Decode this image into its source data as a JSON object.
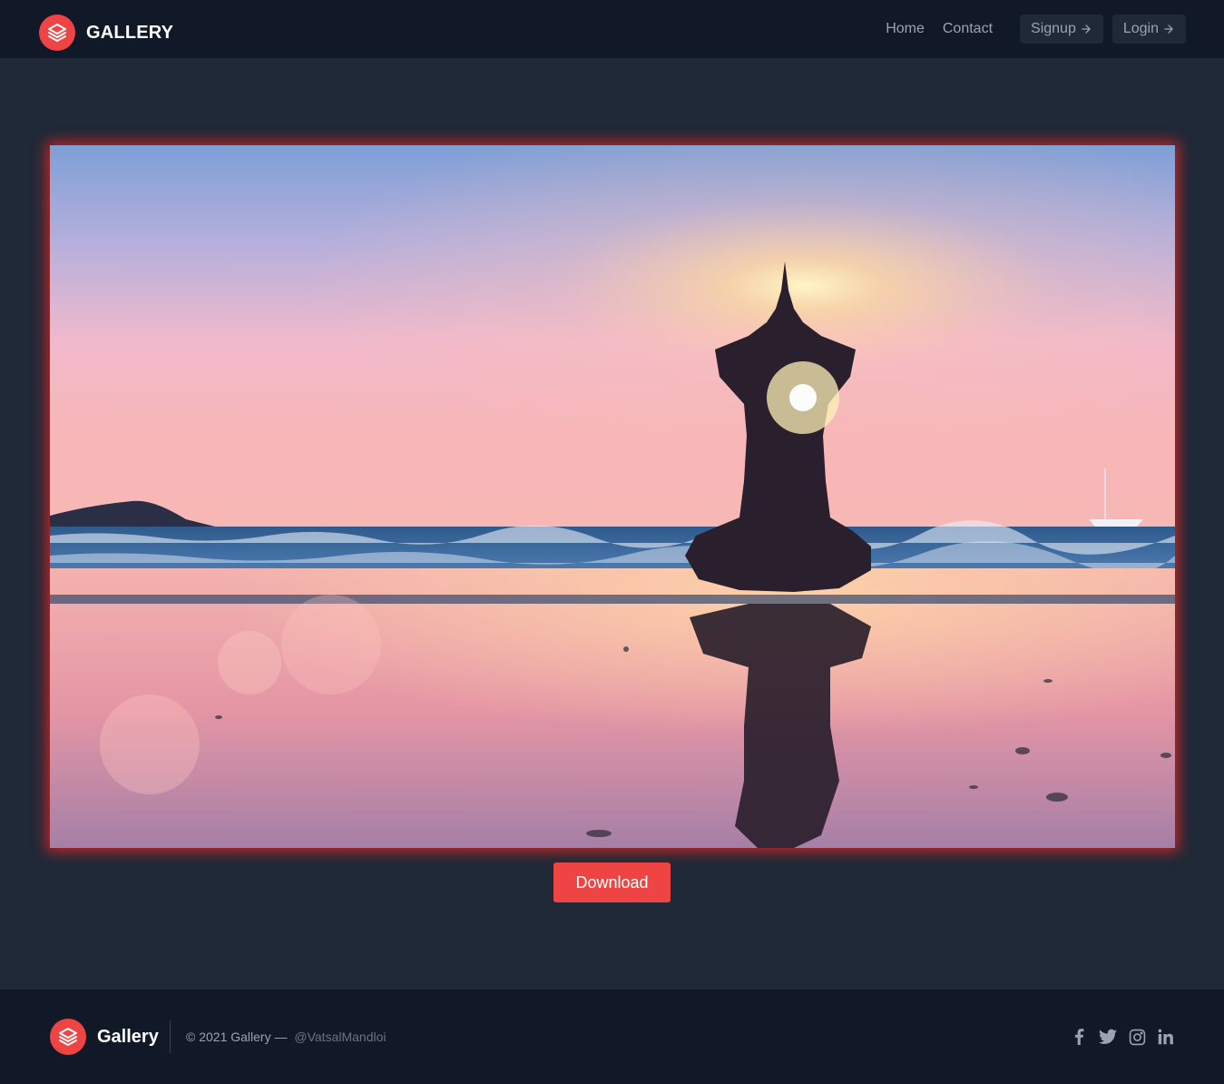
{
  "header": {
    "brand": "GALLERY",
    "nav": {
      "home": "Home",
      "contact": "Contact",
      "signup": "Signup",
      "login": "Login"
    }
  },
  "main": {
    "image_icon": "yoga-sunset-photo",
    "download_label": "Download"
  },
  "footer": {
    "brand": "Gallery",
    "copyright": "© 2021 Gallery —",
    "handle": "@VatsalMandloi",
    "socials": [
      "facebook-icon",
      "twitter-icon",
      "instagram-icon",
      "linkedin-icon"
    ]
  },
  "colors": {
    "accent": "#ef4444",
    "background": "#1f2937",
    "header_bg": "#111827",
    "text_muted": "#9ca3af"
  }
}
